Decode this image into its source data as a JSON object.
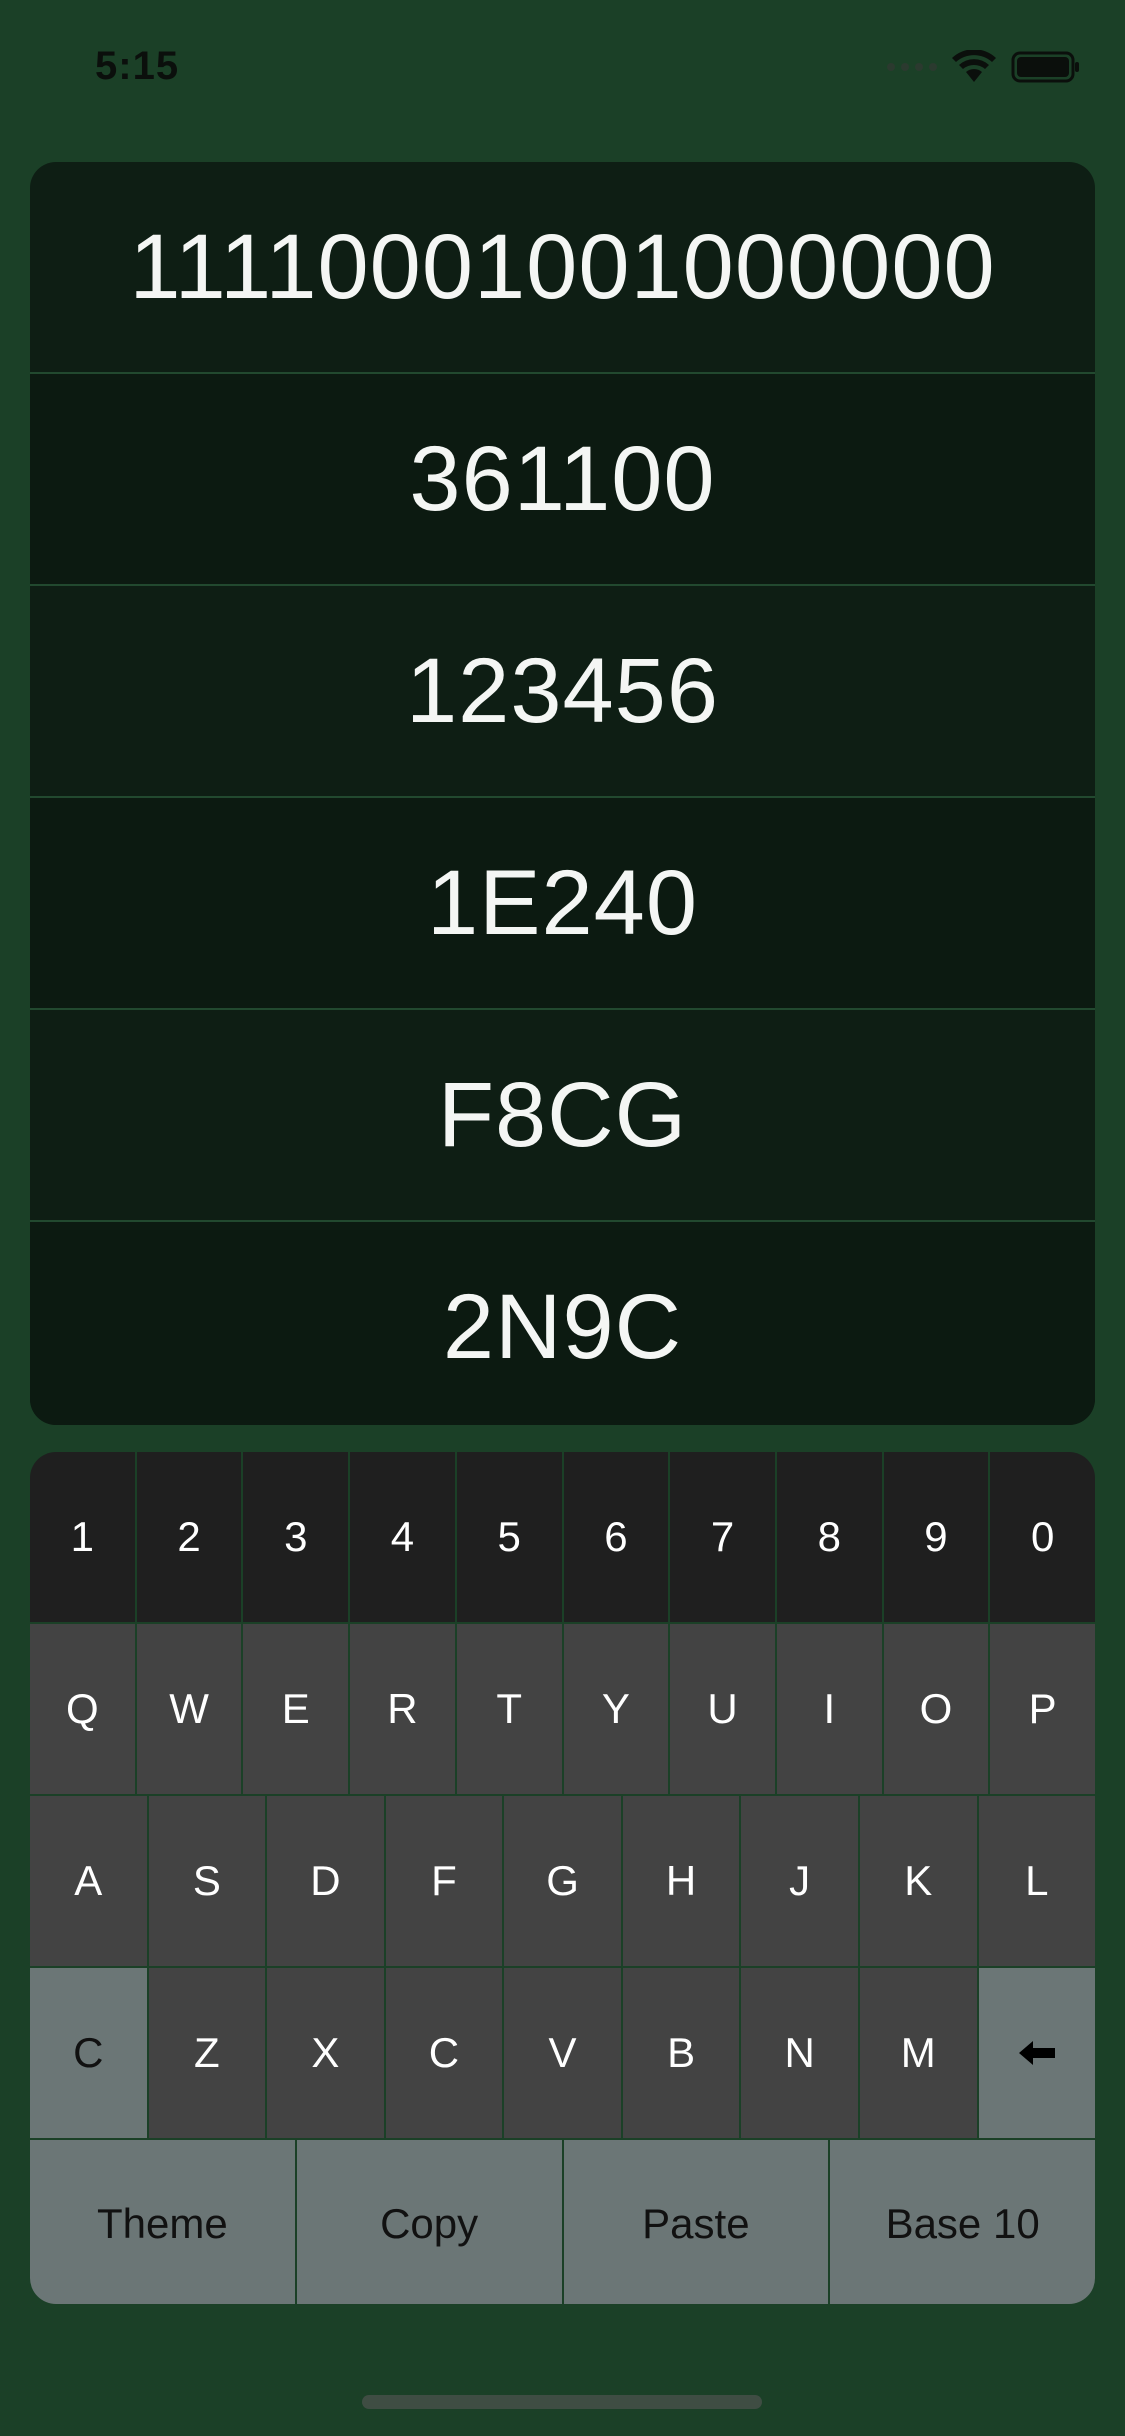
{
  "status_bar": {
    "time": "5:15"
  },
  "values": [
    "11110001001000000",
    "361100",
    "123456",
    "1E240",
    "F8CG",
    "2N9C"
  ],
  "keyboard": {
    "numbers": [
      "1",
      "2",
      "3",
      "4",
      "5",
      "6",
      "7",
      "8",
      "9",
      "0"
    ],
    "row_q": [
      "Q",
      "W",
      "E",
      "R",
      "T",
      "Y",
      "U",
      "I",
      "O",
      "P"
    ],
    "row_a": [
      "A",
      "S",
      "D",
      "F",
      "G",
      "H",
      "J",
      "K",
      "L"
    ],
    "row_z": {
      "clear": "C",
      "keys": [
        "Z",
        "X",
        "C",
        "V",
        "B",
        "N",
        "M"
      ],
      "backspace_icon": "arrow-left-icon"
    },
    "actions": [
      "Theme",
      "Copy",
      "Paste",
      "Base 10"
    ]
  },
  "colors": {
    "background": "#1b4027",
    "panel": "#0e1e14",
    "number_key": "#1f1f1f",
    "letter_key": "#434343",
    "function_key": "#6b7676"
  }
}
